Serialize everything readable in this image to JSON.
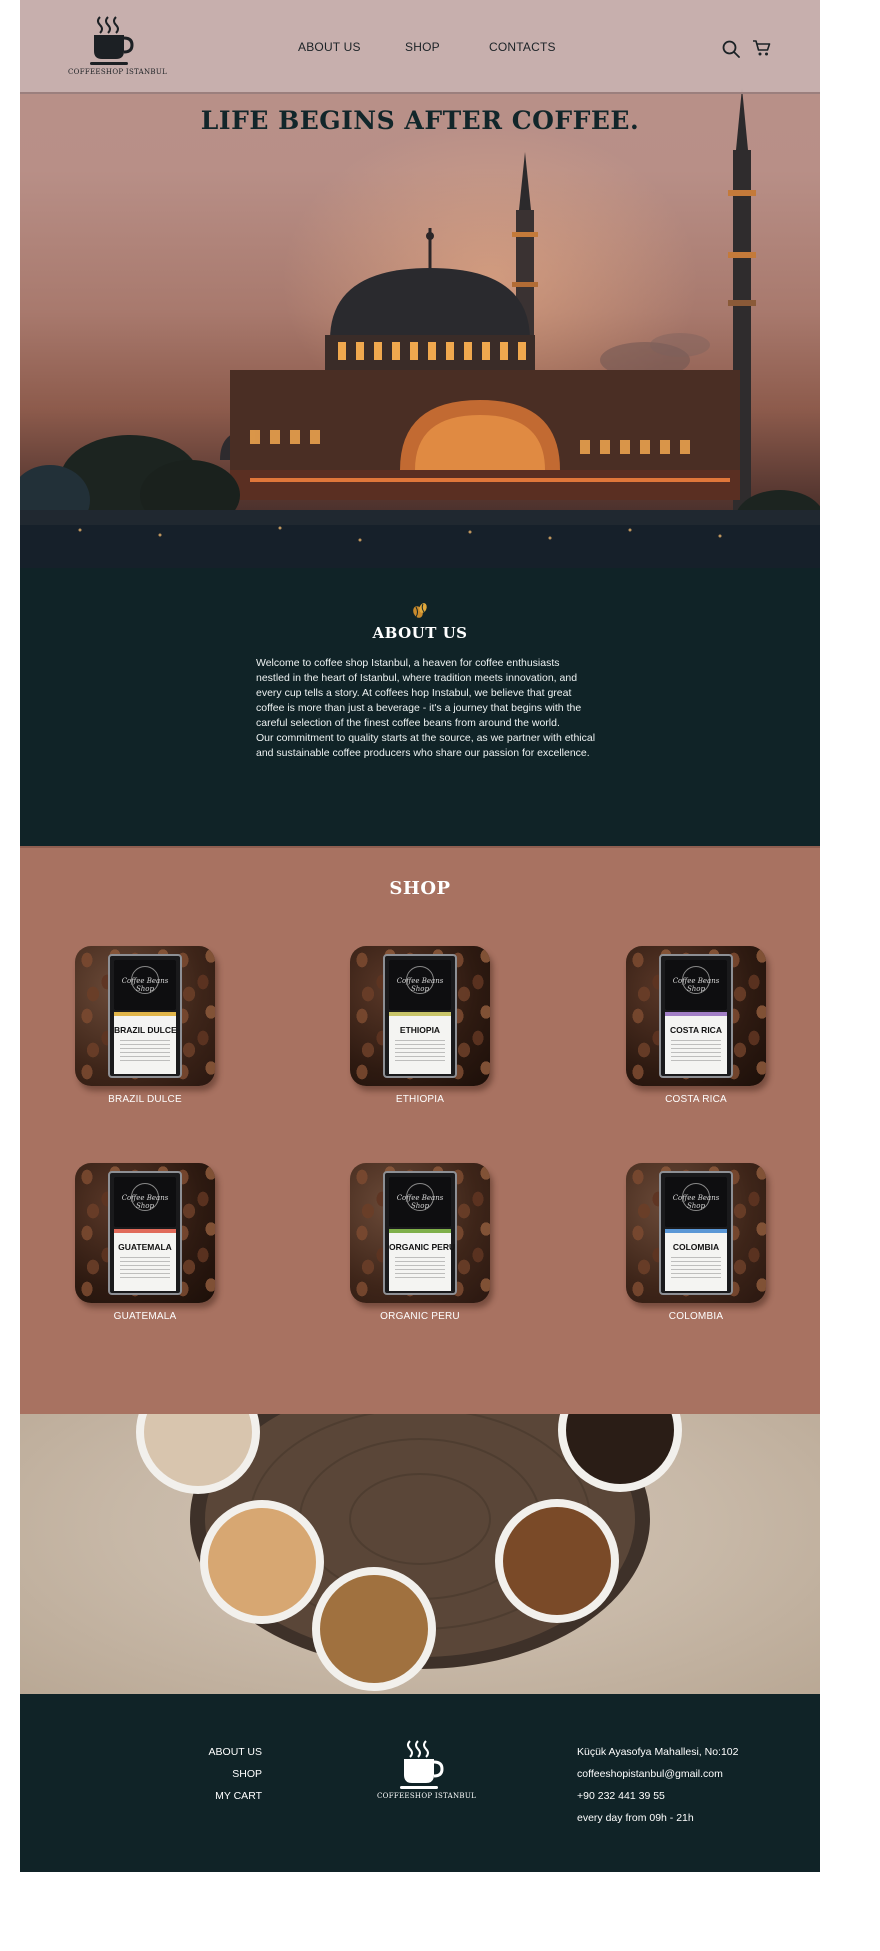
{
  "header": {
    "logo_text": "COFFEESHOP ISTANBUL",
    "nav": [
      {
        "label": "ABOUT US"
      },
      {
        "label": "SHOP"
      },
      {
        "label": "CONTACTS"
      }
    ],
    "icons": [
      "search-icon",
      "cart-icon",
      "coffee-cup-logo-icon"
    ]
  },
  "hero": {
    "title": "LIFE BEGINS AFTER COFFEE."
  },
  "about": {
    "icon": "coffee-beans-icon",
    "title": "ABOUT US",
    "paragraphs": [
      "Welcome to coffee shop Istanbul, a heaven for coffee enthusiasts nestled in the heart of Istanbul, where tradition meets innovation, and every cup tells a story. At coffees hop Instabul, we believe that great coffee is more than just a beverage - it's a journey that begins with the careful selection of the finest coffee beans from around the world.",
      "Our commitment to quality starts at the source, as we partner with ethical and sustainable coffee producers who share our passion for excellence."
    ]
  },
  "shop": {
    "title": "SHOP",
    "bag_brand": "Coffee Beans Shop",
    "products": [
      {
        "name": "BRAZIL DULCE",
        "bag_label": "BRAZIL DULCE",
        "stripe_color": "#e2b64a"
      },
      {
        "name": "ETHIOPIA",
        "bag_label": "ETHIOPIA",
        "stripe_color": "#c9c56a"
      },
      {
        "name": "COSTA RICA",
        "bag_label": "COSTA RICA",
        "stripe_color": "#a27fc6"
      },
      {
        "name": "GUATEMALA",
        "bag_label": "GUATEMALA",
        "stripe_color": "#e06a5a"
      },
      {
        "name": "ORGANIC PERU",
        "bag_label": "ORGANIC PERU",
        "stripe_color": "#7fb04a"
      },
      {
        "name": "COLOMBIA",
        "bag_label": "COLOMBIA",
        "stripe_color": "#5a97d6"
      }
    ]
  },
  "footer": {
    "links": [
      {
        "label": "ABOUT US"
      },
      {
        "label": "SHOP"
      },
      {
        "label": "MY CART"
      }
    ],
    "logo_text": "COFFEESHOP ISTANBUL",
    "address": "Küçük Ayasofya Mahallesi, No:102",
    "email": "coffeeshopistanbul@gmail.com",
    "phone": "+90 232 441 39 55",
    "hours": "every day from 09h - 21h"
  },
  "colors": {
    "dark_teal": "#102327",
    "shop_terracotta": "#a87261",
    "nav_overlay": "#c8b2b0"
  }
}
